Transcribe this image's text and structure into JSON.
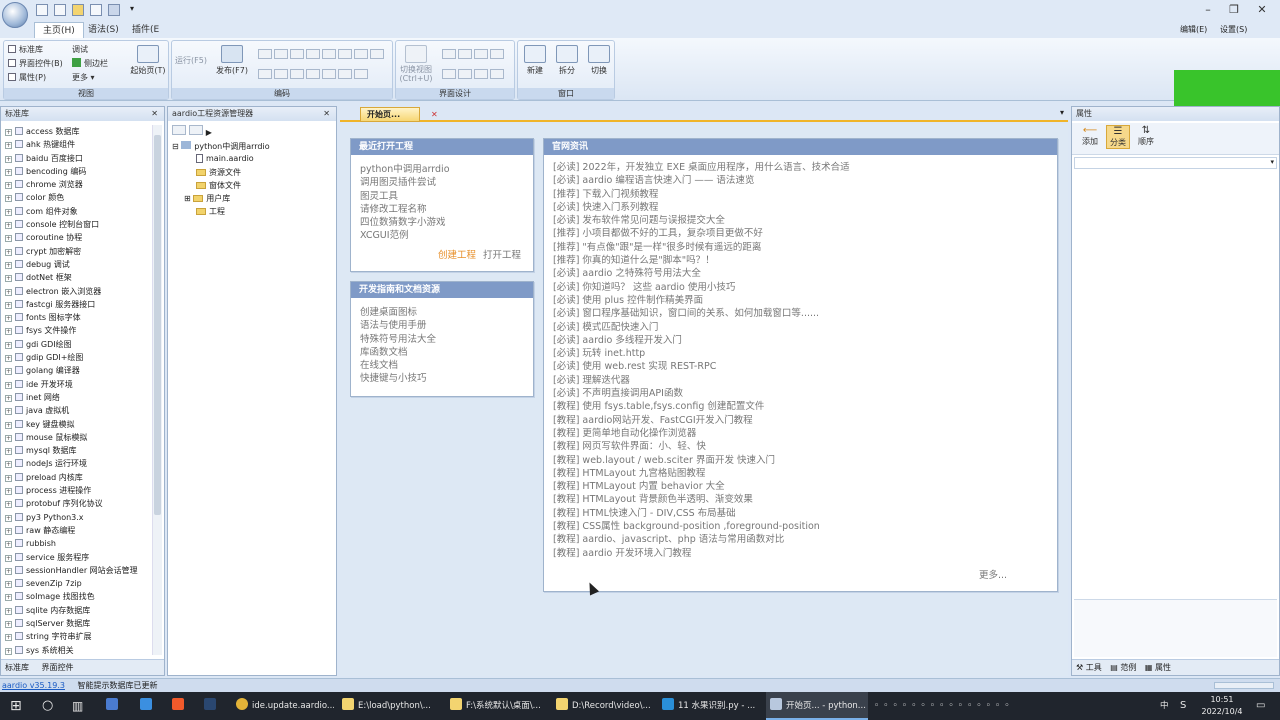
{
  "titlebar": {
    "quick_access": [
      "new",
      "open",
      "save",
      "save-all",
      "dropdown"
    ],
    "minimize": "–",
    "maximize": "❐",
    "close": "✕"
  },
  "ribbon_tabs": [
    {
      "label": "主页(H)",
      "active": true
    },
    {
      "label": "语法(S)",
      "active": false
    },
    {
      "label": "插件(E",
      "active": false
    }
  ],
  "right_menu": {
    "edit": "编辑(E)",
    "settings": "设置(S)"
  },
  "ribbon": {
    "view_group": {
      "checkboxes": [
        {
          "label": "标准库",
          "checked": true
        },
        {
          "label": "界面控件(B)",
          "checked": true
        },
        {
          "label": "属性(P)",
          "checked": true
        }
      ],
      "extra": [
        {
          "label": "调试",
          "icon": "gear-icon"
        },
        {
          "label": "侧边栏",
          "icon": "sidebar-icon"
        },
        {
          "label": "更多 ▾",
          "icon": "list-icon"
        }
      ],
      "start_page_label": "起始页(T)",
      "title": "视图"
    },
    "code_group": {
      "run_label": "运行(F5)",
      "publish_label": "发布(F7)",
      "title": "编码"
    },
    "ui_group": {
      "switch_view_label": "切换视图\n(Ctrl+U)",
      "title": "界面设计"
    },
    "window_group": {
      "new_label": "新建",
      "split_label": "拆分",
      "switch_label": "切换",
      "title": "窗口"
    }
  },
  "library_panel": {
    "title": "标准库",
    "items": [
      "access 数据库",
      "ahk 热键组件",
      "baidu 百度接口",
      "bencoding 编码",
      "chrome 浏览器",
      "color 颜色",
      "com 组件对象",
      "console 控制台窗口",
      "coroutine 协程",
      "crypt 加密解密",
      "debug 调试",
      "dotNet 框架",
      "electron 嵌入浏览器",
      "fastcgi 服务器接口",
      "fonts 图标字体",
      "fsys 文件操作",
      "gdi GDI绘图",
      "gdip GDI+绘图",
      "golang 编译器",
      "ide 开发环境",
      "inet 网络",
      "java 虚拟机",
      "key 键盘模拟",
      "mouse 鼠标模拟",
      "mysql 数据库",
      "nodeJs 运行环境",
      "preload 内核库",
      "process 进程操作",
      "protobuf 序列化协议",
      "py3 Python3.x",
      "raw 静态编程",
      "rubbish",
      "service 服务程序",
      "sessionHandler 网站会话管理",
      "sevenZip 7zip",
      "soImage 找图找色",
      "sqlite 内存数据库",
      "sqlServer 数据库",
      "string 字符串扩展",
      "sys 系统相关"
    ],
    "bottom_tabs": [
      "标准库",
      "界面控件"
    ]
  },
  "project_panel": {
    "title": "aardio工程资源管理器",
    "root": "python中调用arrdio",
    "children": [
      {
        "label": "main.aardio",
        "type": "file"
      },
      {
        "label": "资源文件",
        "type": "folder"
      },
      {
        "label": "窗体文件",
        "type": "folder"
      },
      {
        "label": "用户库",
        "type": "folder"
      },
      {
        "label": "工程",
        "type": "folder"
      }
    ]
  },
  "doc_tab": {
    "label": "开始页..."
  },
  "start_page": {
    "recent": {
      "title": "最近打开工程",
      "items": [
        "python中调用arrdio",
        "调用图灵插件尝试",
        "图灵工具",
        "请修改工程名称",
        "四位数猜数字小游戏",
        "XCGUI范例"
      ],
      "create_label": "创建工程",
      "open_label": "打开工程"
    },
    "guide": {
      "title": "开发指南和文档资源",
      "items": [
        "创建桌面图标",
        "语法与使用手册",
        "特殊符号用法大全",
        "库函数文档",
        "在线文档",
        "快捷键与小技巧"
      ]
    },
    "news": {
      "title": "官网资讯",
      "items": [
        "[必读] 2022年，开发独立 EXE 桌面应用程序，用什么语言、技术合适",
        "[必读] aardio 编程语言快速入门 —— 语法速览",
        "[推荐] 下载入门视频教程",
        "[必读] 快速入门系列教程",
        "[必读] 发布软件常见问题与误报提交大全",
        "[推荐] 小项目都做不好的工具，复杂项目更做不好",
        "[推荐] \"有点像\"跟\"是一样\"很多时候有遥远的距离",
        "[推荐] 你真的知道什么是\"脚本\"吗？！",
        "[必读] aardio 之特殊符号用法大全",
        "[必读] 你知道吗？ 这些 aardio 使用小技巧",
        "[必读] 使用 plus 控件制作精美界面",
        "[必读] 窗口程序基础知识，窗口间的关系、如何加载窗口等......",
        "[必读] 模式匹配快速入门",
        "[必读] aardio 多线程开发入门",
        "[必读] 玩转 inet.http",
        "[必读] 使用 web.rest 实现 REST-RPC",
        "[必读] 理解迭代器",
        "[必读] 不声明直接调用API函数",
        "[教程] 使用 fsys.table,fsys.config 创建配置文件",
        "[教程] aardio网站开发、FastCGI开发入门教程",
        "[教程] 更简单地自动化操作浏览器",
        "[教程] 网页写软件界面：小、轻、快",
        "[教程] web.layout / web.sciter 界面开发 快速入门",
        "[教程] HTMLayout 九宫格贴图教程",
        "[教程] HTMLayout 内置 behavior 大全",
        "[教程] HTMLayout 背景颜色半透明、渐变效果",
        "[教程] HTML快速入门 - DIV,CSS 布局基础",
        "[教程] CSS属性 background-position ,foreground-position",
        "[教程] aardio、javascript、php 语法与常用函数对比",
        "[教程] aardio 开发环境入门教程"
      ],
      "more_label": "更多..."
    }
  },
  "properties_panel": {
    "title": "属性",
    "buttons": [
      "添加",
      "分类",
      "顺序"
    ],
    "bottom_tabs": [
      "工具",
      "范例",
      "属性"
    ]
  },
  "status": {
    "version": "aardio v35.19.3",
    "message": "智能提示数据库已更新"
  },
  "taskbar": {
    "items": [
      "ide.update.aardio...",
      "E:\\load\\python\\...",
      "F:\\系统默认\\桌面\\...",
      "D:\\Record\\video\\...",
      "11 水果识别.py - ...",
      "开始页... - python..."
    ],
    "time": "10:51",
    "date": "2022/10/4",
    "ime": "中"
  },
  "colors": {
    "accent_green": "#39c42b",
    "card_header": "#7f9ac7",
    "link_orange": "#e7902b"
  }
}
